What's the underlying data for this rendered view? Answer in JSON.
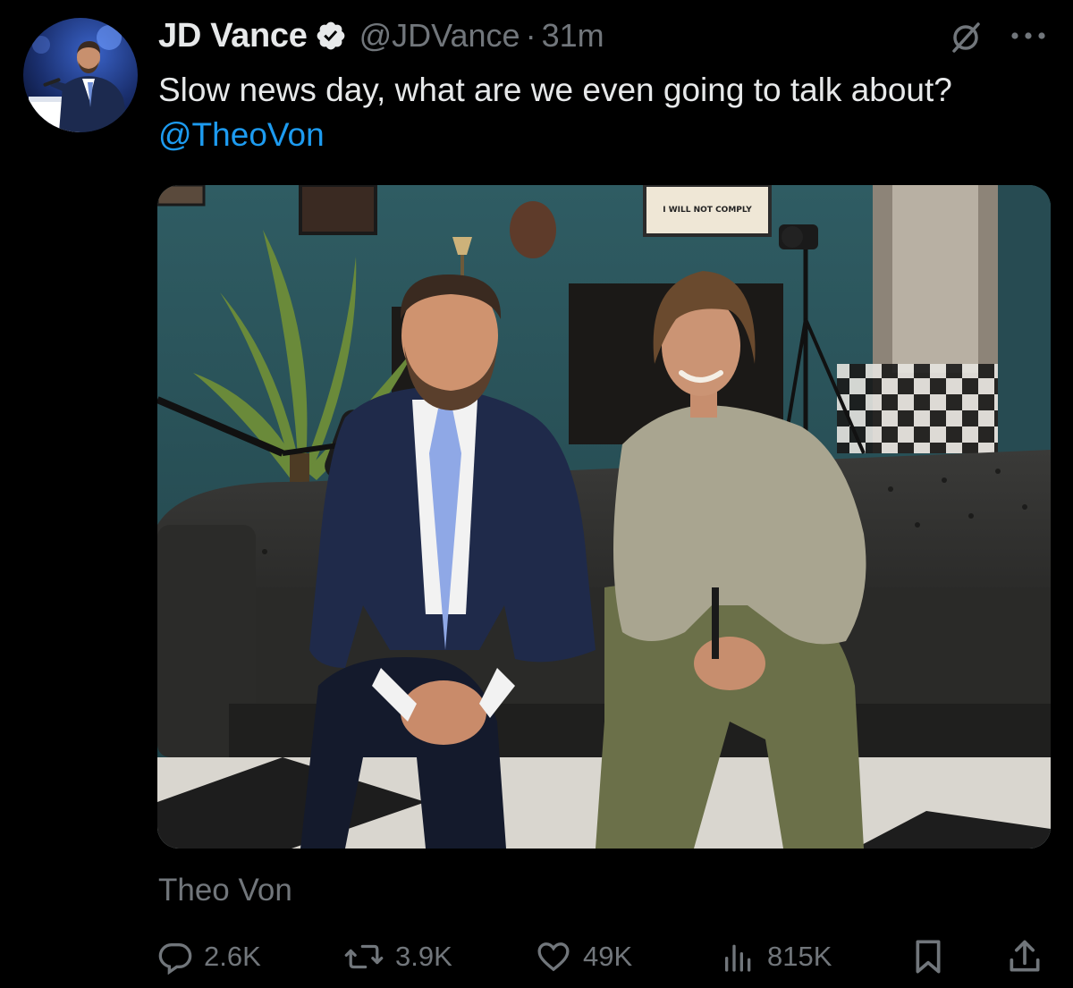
{
  "author": {
    "name": "JD Vance",
    "handle": "@JDVance",
    "separator": "·",
    "time": "31m",
    "verified": true
  },
  "tweet": {
    "text_prefix": "Slow news day, what are we even going to talk about? ",
    "mention": "@TheoVon"
  },
  "media": {
    "sign_text": "I WILL NOT COMPLY",
    "tagged_user": "Theo Von"
  },
  "actions": {
    "replies": "2.6K",
    "reposts": "3.9K",
    "likes": "49K",
    "views": "815K"
  },
  "icons": [
    "verified-icon",
    "grok-icon",
    "more-icon",
    "reply-icon",
    "repost-icon",
    "like-icon",
    "views-icon",
    "bookmark-icon",
    "share-icon"
  ],
  "colors": {
    "background": "#000000",
    "text": "#e7e9ea",
    "secondary": "#71767b",
    "link": "#1d9bf0"
  }
}
